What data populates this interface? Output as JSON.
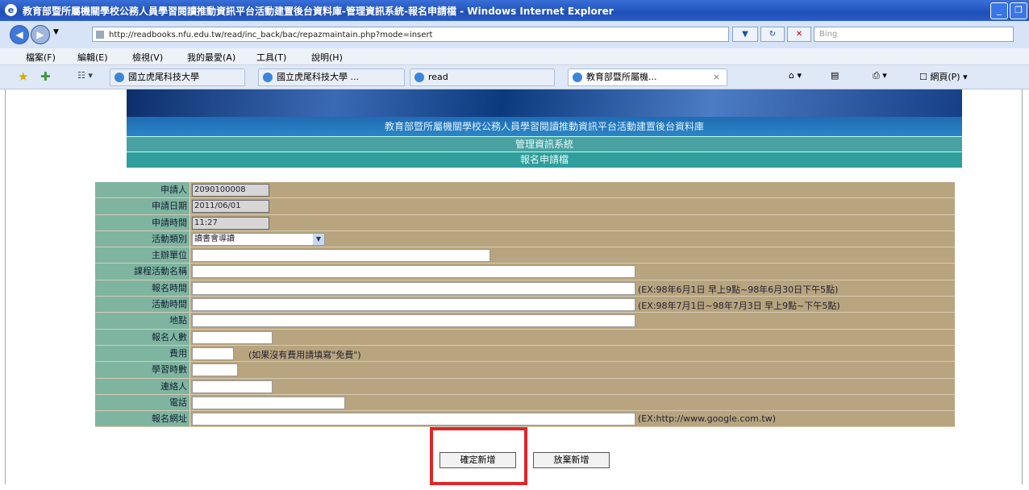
{
  "window": {
    "title": "教育部暨所屬機關學校公務人員學習閱讀推動資訊平台活動建置後台資料庫-管理資訊系統-報名申請檔 - Windows Internet Explorer",
    "minimize": "_",
    "restore": "❐"
  },
  "address_bar": {
    "url": "http://readbooks.nfu.edu.tw/read/inc_back/bac/repazmaintain.php?mode=insert",
    "search_placeholder": "Bing"
  },
  "menu": [
    "檔案(F)",
    "編輯(E)",
    "檢視(V)",
    "我的最愛(A)",
    "工具(T)",
    "說明(H)"
  ],
  "tabs": [
    {
      "label": "國立虎尾科技大學"
    },
    {
      "label": "國立虎尾科技大學 ..."
    },
    {
      "label": "read"
    },
    {
      "label": "教育部暨所屬機...",
      "close": "×"
    }
  ],
  "command_bar": {
    "page": "網頁(P)"
  },
  "banner": {
    "title": "教育部暨所屬機關學校公務人員學習閱讀推動資訊平台活動建置後台資料庫",
    "system": "管理資訊系統",
    "section": "報名申請檔"
  },
  "form": {
    "rows": [
      {
        "label": "申請人",
        "value": "2090100008",
        "hint": ""
      },
      {
        "label": "申請日期",
        "value": "2011/06/01",
        "hint": ""
      },
      {
        "label": "申請時間",
        "value": "11:27",
        "hint": ""
      },
      {
        "label": "活動類別",
        "value": "讀書會導讀",
        "hint": ""
      },
      {
        "label": "主辦單位",
        "value": "",
        "hint": ""
      },
      {
        "label": "課程活動名稱",
        "value": "",
        "hint": ""
      },
      {
        "label": "報名時間",
        "value": "",
        "hint": "(EX:98年6月1日 早上9點~98年6月30日下午5點)"
      },
      {
        "label": "活動時間",
        "value": "",
        "hint": "(EX:98年7月1日~98年7月3日 早上9點~下午5點)"
      },
      {
        "label": "地點",
        "value": "",
        "hint": ""
      },
      {
        "label": "報名人數",
        "value": "",
        "hint": ""
      },
      {
        "label": "費用",
        "value": "",
        "hint": "(如果沒有費用請填寫\"免費\")"
      },
      {
        "label": "學習時數",
        "value": "",
        "hint": ""
      },
      {
        "label": "連絡人",
        "value": "",
        "hint": ""
      },
      {
        "label": "電話",
        "value": "",
        "hint": ""
      },
      {
        "label": "報名網址",
        "value": "",
        "hint": "(EX:http://www.google.com.tw)"
      }
    ]
  },
  "buttons": {
    "confirm": "確定新增",
    "cancel": "放棄新增"
  },
  "colors": {
    "label_bg": "#7fb4a0",
    "row_bg": "#b8a47e",
    "highlight": "#e0262a"
  }
}
